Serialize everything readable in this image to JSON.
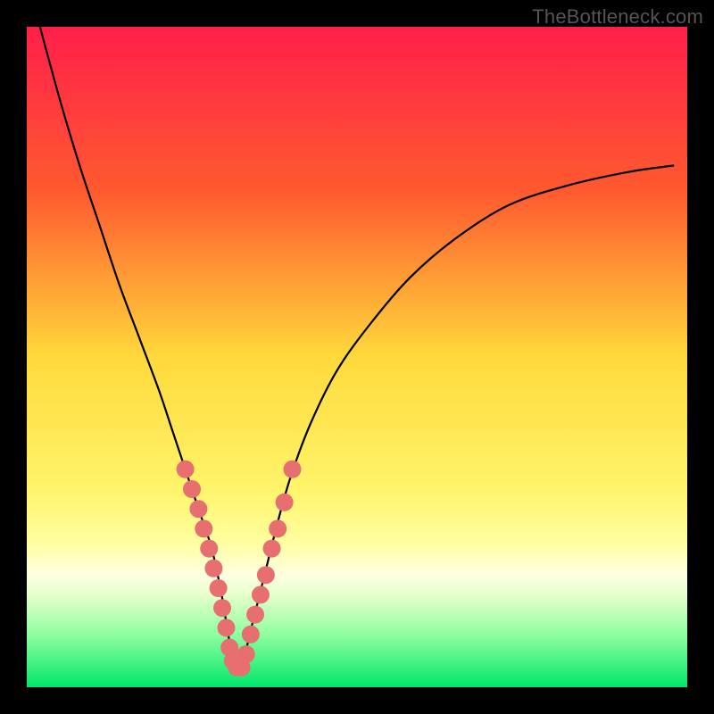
{
  "watermark": "TheBottleneck.com",
  "chart_data": {
    "type": "line",
    "title": "",
    "xlabel": "",
    "ylabel": "",
    "xlim": [
      0,
      100
    ],
    "ylim": [
      0,
      100
    ],
    "grid": false,
    "legend": false,
    "background": {
      "stops": [
        {
          "offset": 0,
          "color": "#ff1f4a"
        },
        {
          "offset": 25,
          "color": "#ff5a2f"
        },
        {
          "offset": 50,
          "color": "#ffd93b"
        },
        {
          "offset": 70,
          "color": "#fff46a"
        },
        {
          "offset": 78,
          "color": "#ffffa0"
        },
        {
          "offset": 83,
          "color": "#ffffe0"
        },
        {
          "offset": 86,
          "color": "#e6ffcc"
        },
        {
          "offset": 92,
          "color": "#8fffa0"
        },
        {
          "offset": 100,
          "color": "#00e66a"
        }
      ]
    },
    "curve": {
      "name": "bottleneck-curve",
      "color": "#000000",
      "x": [
        2,
        5,
        8,
        11,
        14,
        17,
        20,
        22,
        24,
        26,
        28,
        29.5,
        30.5,
        31.5,
        32.5,
        34,
        36,
        38,
        40,
        43,
        47,
        52,
        58,
        65,
        73,
        82,
        91,
        98
      ],
      "y": [
        100,
        89,
        79,
        70,
        61,
        53,
        45,
        39,
        33,
        27,
        21,
        14,
        8,
        3,
        3,
        9,
        17,
        25,
        32,
        40,
        48,
        55,
        62,
        68,
        73,
        76,
        78,
        79
      ]
    },
    "accent_dots": {
      "name": "highlight-dots",
      "color": "#e76f6f",
      "radius": 10,
      "points": [
        {
          "x": 24.0,
          "y": 33
        },
        {
          "x": 25.0,
          "y": 30
        },
        {
          "x": 26.0,
          "y": 27
        },
        {
          "x": 26.8,
          "y": 24
        },
        {
          "x": 27.6,
          "y": 21
        },
        {
          "x": 28.3,
          "y": 18
        },
        {
          "x": 29.0,
          "y": 15
        },
        {
          "x": 29.6,
          "y": 12
        },
        {
          "x": 30.2,
          "y": 9
        },
        {
          "x": 30.7,
          "y": 6
        },
        {
          "x": 31.2,
          "y": 4
        },
        {
          "x": 31.8,
          "y": 3
        },
        {
          "x": 32.5,
          "y": 3
        },
        {
          "x": 33.2,
          "y": 5
        },
        {
          "x": 33.9,
          "y": 8
        },
        {
          "x": 34.6,
          "y": 11
        },
        {
          "x": 35.4,
          "y": 14
        },
        {
          "x": 36.2,
          "y": 17
        },
        {
          "x": 37.1,
          "y": 21
        },
        {
          "x": 38.0,
          "y": 24
        },
        {
          "x": 39.0,
          "y": 28
        },
        {
          "x": 40.2,
          "y": 33
        }
      ]
    }
  }
}
